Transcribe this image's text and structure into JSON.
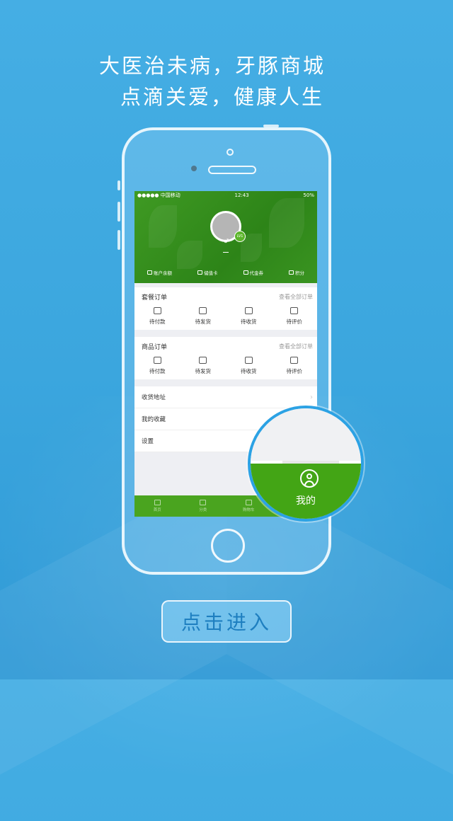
{
  "headline": {
    "line1": "大医治未病，牙豚商城",
    "line2": "点滴关爱，健康人生"
  },
  "status_bar": {
    "carrier": "●●●●● 中国移动",
    "time": "12:43",
    "battery": "50%"
  },
  "profile": {
    "level": "LV1",
    "gender_icon": "♂",
    "name": "—"
  },
  "account_items": [
    {
      "icon": "purse-icon",
      "label": "账户余额"
    },
    {
      "icon": "card-icon",
      "label": "储值卡"
    },
    {
      "icon": "coupon-icon",
      "label": "代金券"
    },
    {
      "icon": "points-icon",
      "label": "积分"
    }
  ],
  "package_orders": {
    "title": "套餐订单",
    "view_all": "查看全部订单",
    "items": [
      "待付款",
      "待发货",
      "待收货",
      "待评价"
    ]
  },
  "product_orders": {
    "title": "商品订单",
    "view_all": "查看全部订单",
    "items": [
      "待付款",
      "待发货",
      "待收货",
      "待评价"
    ]
  },
  "menu": [
    {
      "label": "收货地址",
      "chevron": "›"
    },
    {
      "label": "我的收藏",
      "chevron": ""
    },
    {
      "label": "设置",
      "chevron": ""
    }
  ],
  "tabbar": [
    {
      "label": "首页",
      "icon": "home-icon"
    },
    {
      "label": "分类",
      "icon": "list-icon"
    },
    {
      "label": "购物车",
      "icon": "cart-icon"
    },
    {
      "label": "我的",
      "icon": "user-icon"
    }
  ],
  "magnifier": {
    "label": "我的",
    "icon": "user-icon"
  },
  "enter_button": {
    "label": "点击进入"
  },
  "colors": {
    "background": "#3ba6de",
    "brand_green": "#43a515",
    "accent_blue": "#2ca2e4"
  }
}
